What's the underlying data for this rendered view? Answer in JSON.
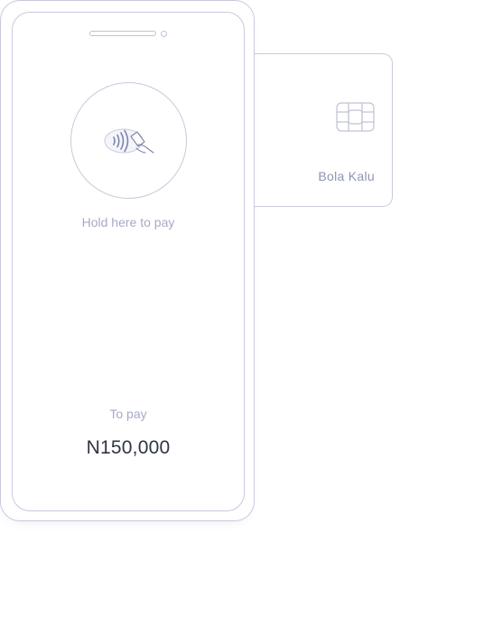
{
  "card": {
    "holder_name": "Bola Kalu",
    "chip_icon": "card-chip-icon"
  },
  "phone": {
    "tap_icon": "contactless-tap-icon",
    "hold_instruction": "Hold here to pay",
    "to_pay_label": "To pay",
    "amount": "N150,000"
  },
  "colors": {
    "outline": "#c9c9dc",
    "muted_text": "#a6aac7",
    "card_text": "#8f93b4",
    "amount_text": "#2f3445"
  }
}
